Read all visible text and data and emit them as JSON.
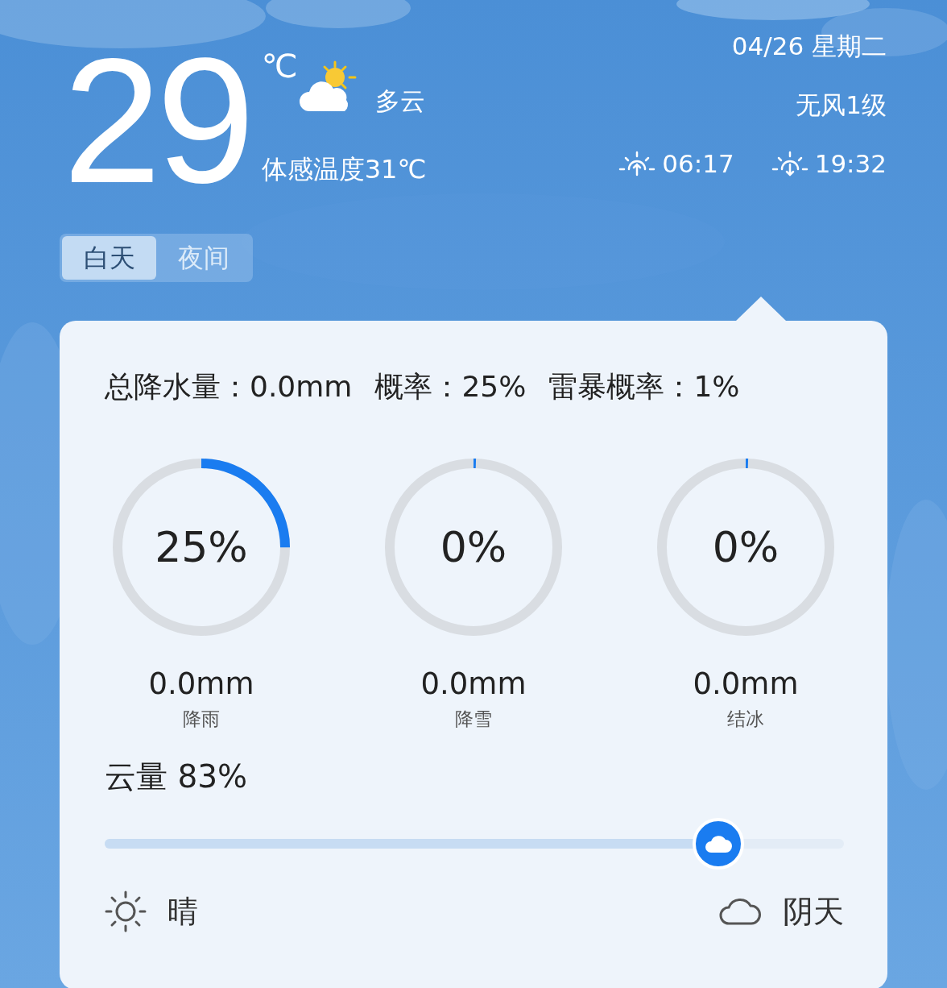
{
  "header": {
    "temperature": "29",
    "unit": "℃",
    "condition": "多云",
    "feels_like": "体感温度31℃",
    "date": "04/26 星期二",
    "wind": "无风1级",
    "sunrise": "06:17",
    "sunset": "19:32"
  },
  "tabs": [
    {
      "label": "白天",
      "selected": true
    },
    {
      "label": "夜间",
      "selected": false
    }
  ],
  "card": {
    "summary": [
      {
        "label": "总降水量：",
        "value": "0.0mm"
      },
      {
        "label": "概率：",
        "value": "25%"
      },
      {
        "label": "雷暴概率：",
        "value": "1%"
      }
    ],
    "gauges": [
      {
        "percent": "25%",
        "amount": "0.0mm",
        "label": "降雨"
      },
      {
        "percent": "0%",
        "amount": "0.0mm",
        "label": "降雪"
      },
      {
        "percent": "0%",
        "amount": "0.0mm",
        "label": "结冰"
      }
    ],
    "cloud_cover": {
      "label": "云量 83%",
      "level": 0.83,
      "min_label": "晴",
      "max_label": "阴天"
    }
  }
}
